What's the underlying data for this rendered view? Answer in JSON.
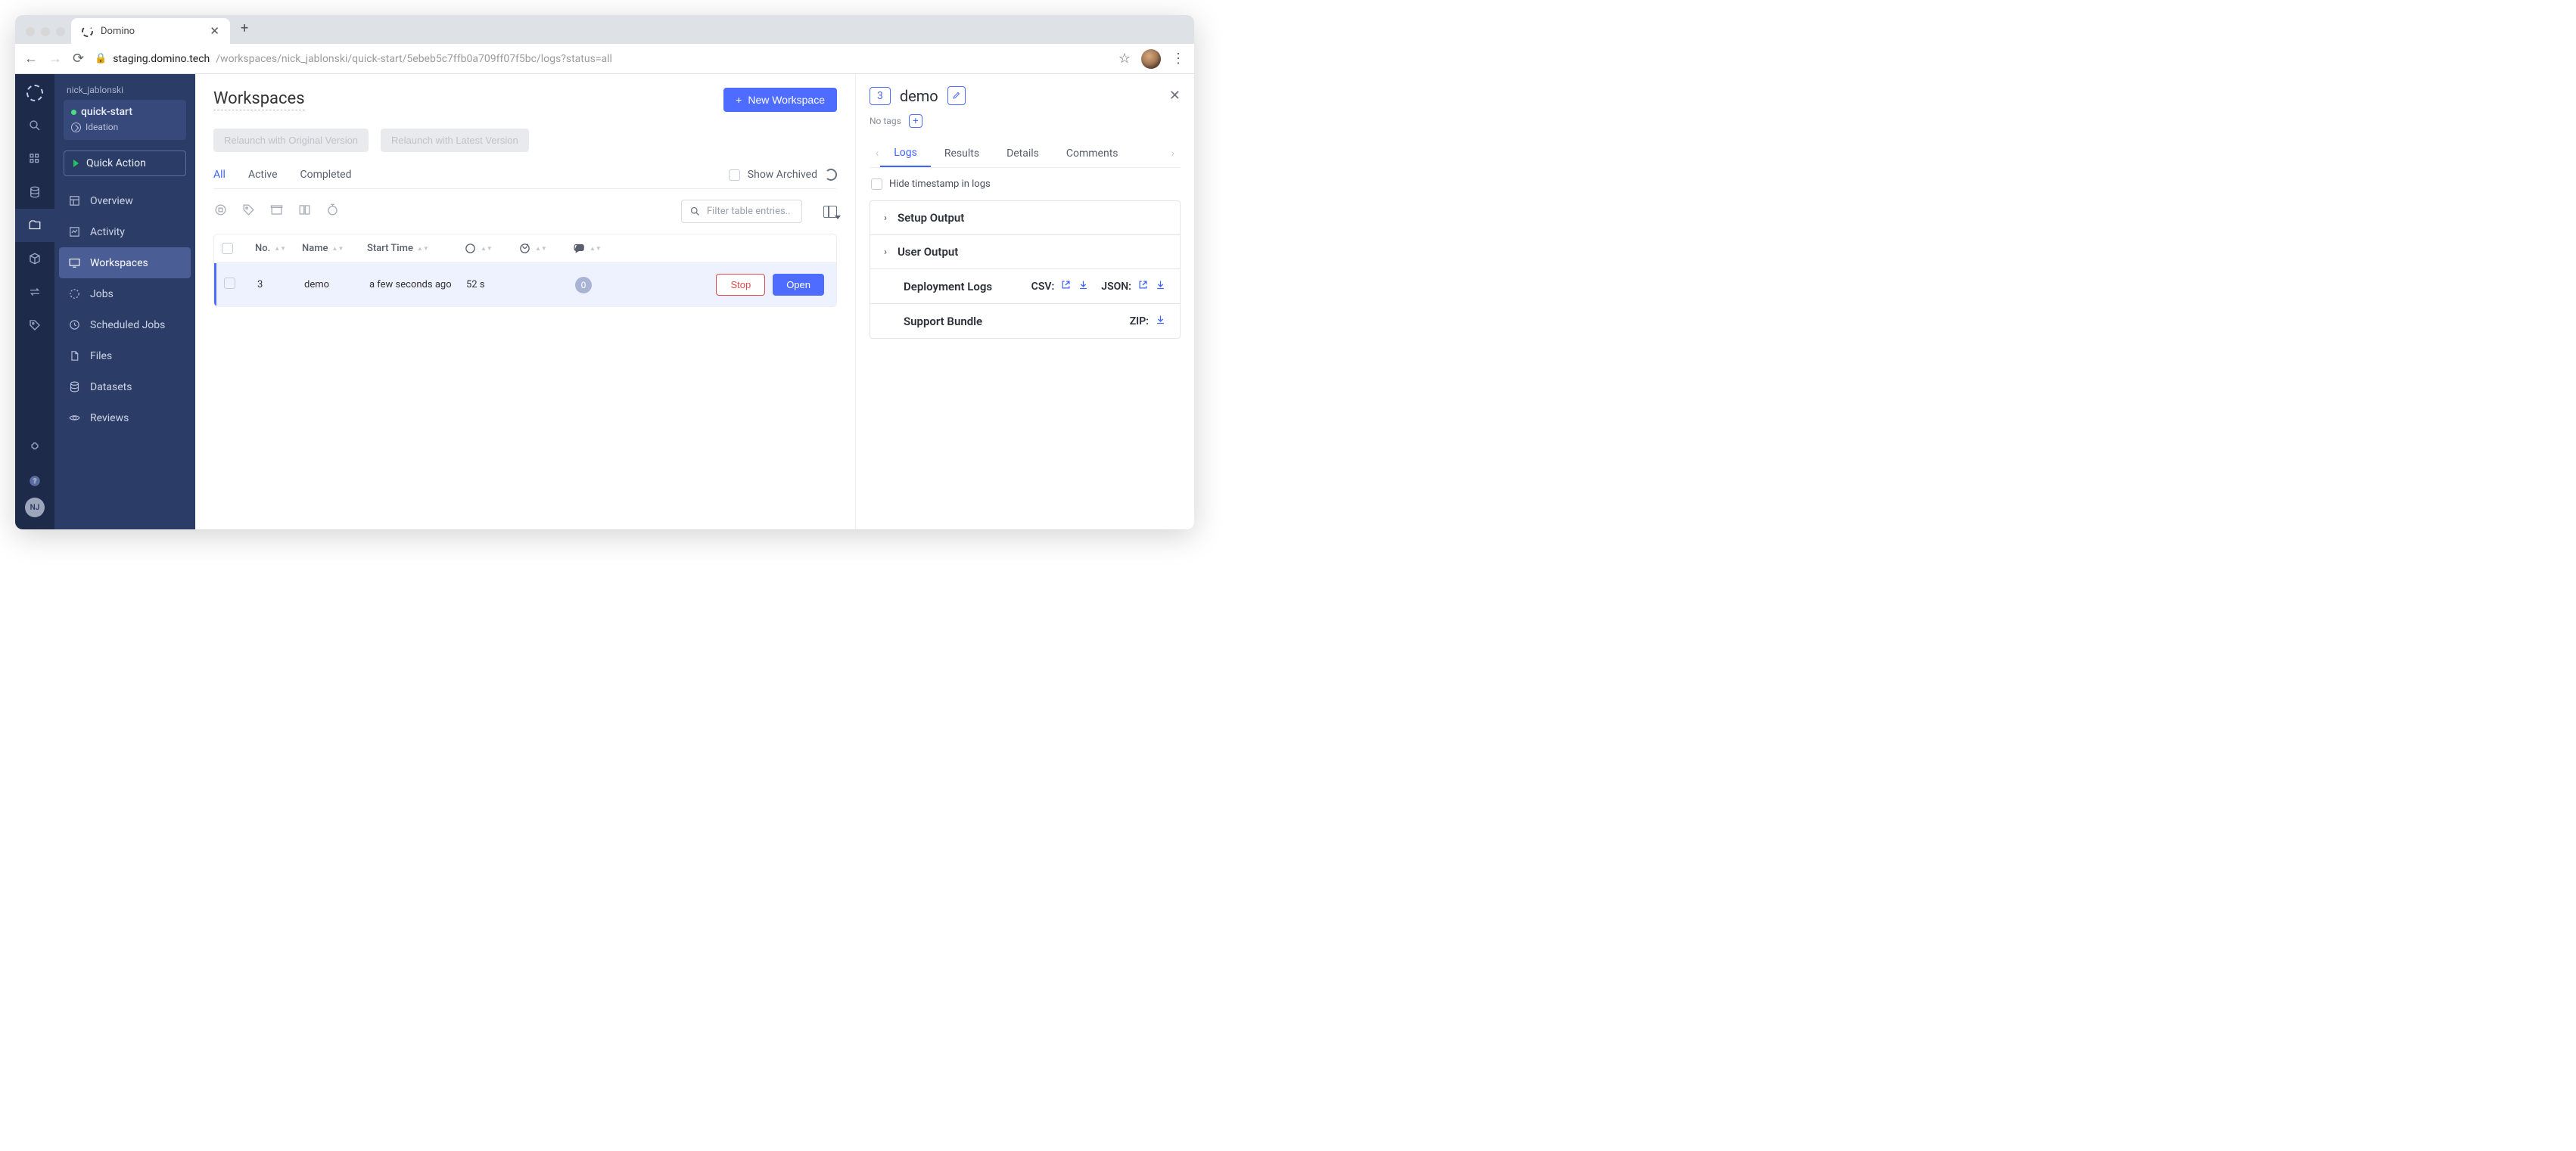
{
  "browser": {
    "tab_title": "Domino",
    "url_host": "staging.domino.tech",
    "url_path": "/workspaces/nick_jablonski/quick-start/5ebeb5c7ffb0a709ff07f5bc/logs?status=all"
  },
  "rail": {
    "avatar_initials": "NJ"
  },
  "sidenav": {
    "breadcrumb": "nick_jablonski",
    "project_name": "quick-start",
    "project_stage": "Ideation",
    "quick_action": "Quick Action",
    "items": [
      {
        "label": "Overview"
      },
      {
        "label": "Activity"
      },
      {
        "label": "Workspaces"
      },
      {
        "label": "Jobs"
      },
      {
        "label": "Scheduled Jobs"
      },
      {
        "label": "Files"
      },
      {
        "label": "Datasets"
      },
      {
        "label": "Reviews"
      }
    ]
  },
  "page": {
    "title": "Workspaces",
    "new_button": "New Workspace",
    "relaunch_original": "Relaunch with Original Version",
    "relaunch_latest": "Relaunch with Latest Version",
    "filters": {
      "all": "All",
      "active": "Active",
      "completed": "Completed"
    },
    "show_archived": "Show Archived",
    "search_placeholder": "Filter table entries..",
    "columns": {
      "no": "No.",
      "name": "Name",
      "start": "Start Time"
    },
    "row": {
      "no": "3",
      "name": "demo",
      "start": "a few seconds ago",
      "duration": "52 s",
      "comments": "0",
      "stop": "Stop",
      "open": "Open"
    }
  },
  "panel": {
    "number": "3",
    "title": "demo",
    "no_tags": "No tags",
    "tabs": {
      "logs": "Logs",
      "results": "Results",
      "details": "Details",
      "comments": "Comments"
    },
    "hide_ts": "Hide timestamp in logs",
    "setup_output": "Setup Output",
    "user_output": "User Output",
    "deployment_logs": "Deployment Logs",
    "csv_label": "CSV:",
    "json_label": "JSON:",
    "support_bundle": "Support Bundle",
    "zip_label": "ZIP:"
  }
}
